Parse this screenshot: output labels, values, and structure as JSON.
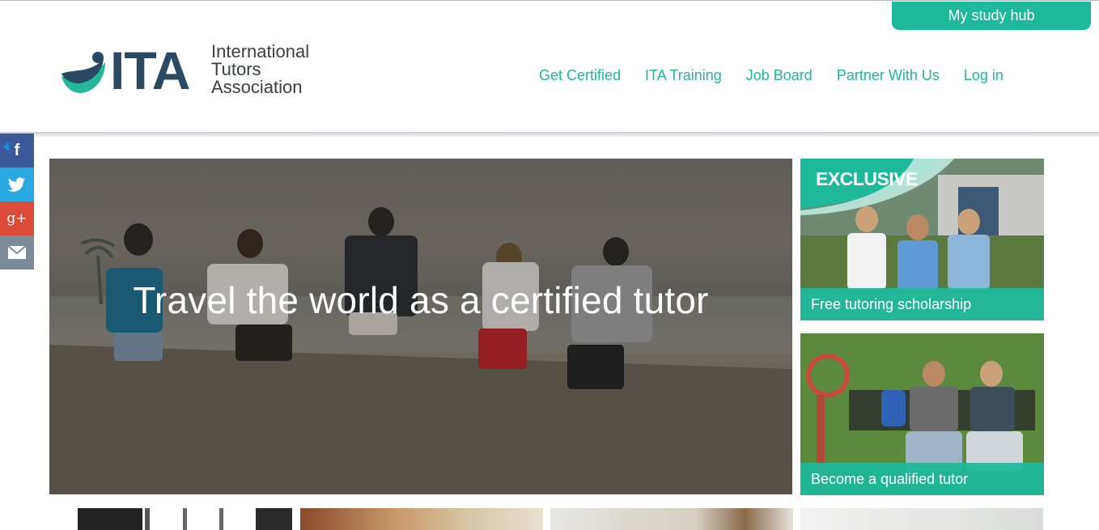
{
  "header": {
    "study_hub_label": "My study hub",
    "logo": {
      "mark_text": "ITA",
      "name_line1": "International",
      "name_line2": "Tutors",
      "name_line3": "Association"
    },
    "nav": [
      {
        "label": "Get Certified"
      },
      {
        "label": "ITA Training"
      },
      {
        "label": "Job Board"
      },
      {
        "label": "Partner With Us"
      },
      {
        "label": "Log in"
      }
    ]
  },
  "social": {
    "items": [
      {
        "icon": "facebook-icon",
        "glyph": "f",
        "color": "#3b5a9a"
      },
      {
        "icon": "twitter-icon",
        "color": "#28a9e1"
      },
      {
        "icon": "google-plus-icon",
        "glyph": "g+",
        "color": "#dc4a38"
      },
      {
        "icon": "email-icon",
        "color": "#7d8b96"
      }
    ]
  },
  "hero": {
    "title": "Travel the world as a certified tutor"
  },
  "cards": [
    {
      "badge": "EXCLUSIVE",
      "caption": "Free tutoring scholarship"
    },
    {
      "caption": "Become a qualified tutor"
    }
  ],
  "colors": {
    "accent": "#1db99a",
    "logo_dark": "#2a4a63"
  }
}
